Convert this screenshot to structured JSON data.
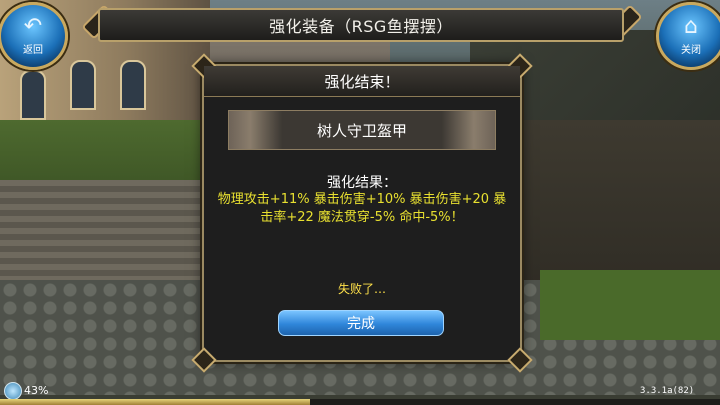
{
  "header": {
    "title": "强化装备（RSG鱼摆摆）"
  },
  "nav": {
    "back_label": "返回",
    "back_icon": "back-arrow-icon",
    "close_label": "关闭",
    "close_icon": "house-icon"
  },
  "dialog": {
    "title": "强化结束！",
    "item_name": "树人守卫盔甲",
    "result_label": "强化结果：",
    "result_text": "物理攻击+11% 暴击伤害+10% 暴击伤害+20 暴击率+22 魔法贯穿-5% 命中-5%！",
    "status_text": "失败了…",
    "confirm_label": "完成"
  },
  "footer": {
    "progress_text": "43%",
    "progress_value": 0.43,
    "version": "3.3.1a(82)"
  },
  "colors": {
    "result_text": "#e8e030",
    "button_blue": "#2f86da",
    "frame_gold": "#b8a06a"
  }
}
